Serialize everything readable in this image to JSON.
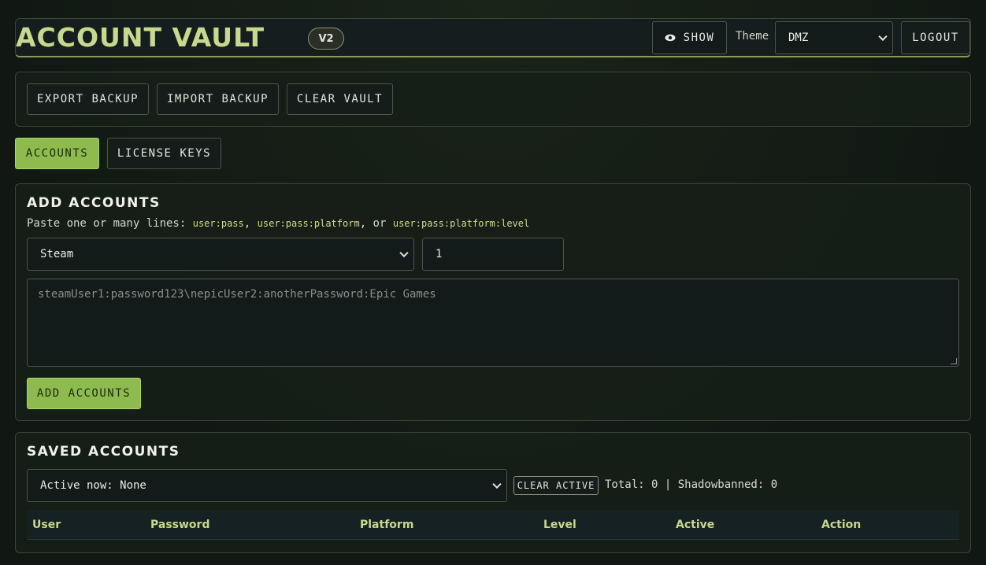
{
  "header": {
    "title": "ACCOUNT VAULT",
    "version_badge": "V2",
    "show_label": "SHOW",
    "theme_label": "Theme",
    "theme_value": "DMZ",
    "logout_label": "LOGOUT"
  },
  "toolbar": {
    "export_label": "EXPORT BACKUP",
    "import_label": "IMPORT BACKUP",
    "clear_label": "CLEAR VAULT"
  },
  "tabs": [
    {
      "label": "ACCOUNTS",
      "active": true
    },
    {
      "label": "LICENSE KEYS",
      "active": false
    }
  ],
  "add_accounts": {
    "heading": "ADD ACCOUNTS",
    "hint_prefix": "Paste one or many lines:",
    "format1": "user:pass",
    "sep1": ",",
    "format2": "user:pass:platform",
    "sep2": ", or",
    "format3": "user:pass:platform:level",
    "platform_value": "Steam",
    "level_value": "1",
    "textarea_placeholder": "steamUser1:password123\\nepicUser2:anotherPassword:Epic Games",
    "submit_label": "ADD ACCOUNTS"
  },
  "saved_accounts": {
    "heading": "SAVED ACCOUNTS",
    "active_select_value": "Active now: None",
    "clear_active_label": "CLEAR ACTIVE",
    "stats": "Total: 0 | Shadowbanned: 0",
    "columns": [
      "User",
      "Password",
      "Platform",
      "Level",
      "Active",
      "Action"
    ]
  },
  "colors": {
    "accent_green": "#8dbb4e",
    "title_green": "#c7d98c",
    "background": "#121a14"
  }
}
